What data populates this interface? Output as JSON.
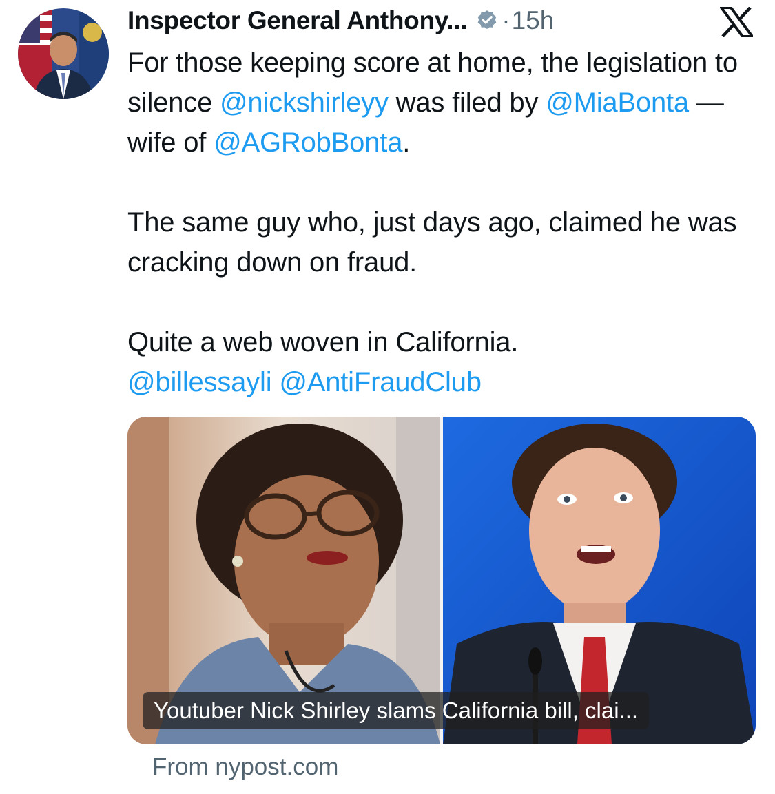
{
  "author": {
    "name": "Inspector General Anthony...",
    "verified": true,
    "separator": "·",
    "timestamp": "15h",
    "avatar_icon": "profile-photo"
  },
  "platform_icon": "x-logo-icon",
  "tweet": {
    "p1_a": "For those keeping score at home, the legislation to silence ",
    "p1_m1": "@nickshirleyy",
    "p1_b": " was filed by ",
    "p1_m2": "@MiaBonta",
    "p1_c": " — wife of ",
    "p1_m3": "@AGRobBonta",
    "p1_d": ".",
    "p2": "The same guy who, just days ago, claimed he was cracking down on fraud.",
    "p3": "Quite a web woven in California.",
    "p3_m1": "@billessayli",
    "p3_m2": "@AntiFraudClub"
  },
  "card": {
    "caption": "Youtuber Nick Shirley slams California bill, clai...",
    "source": "From nypost.com"
  },
  "colors": {
    "mention": "#1d9bf0",
    "text": "#0f1419",
    "secondary": "#536471"
  }
}
